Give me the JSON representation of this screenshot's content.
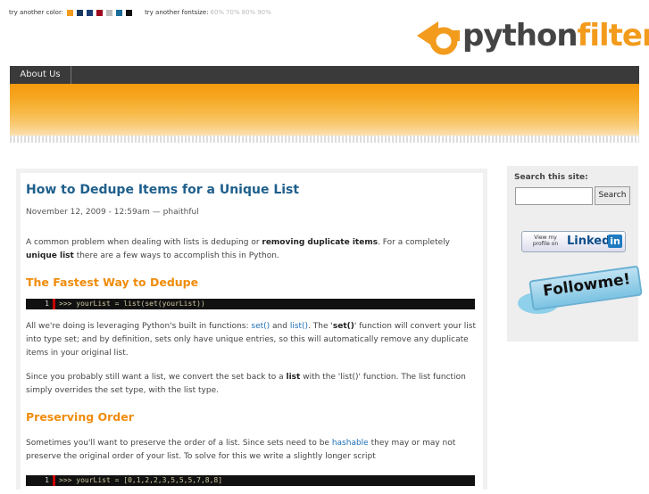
{
  "topbar": {
    "color_label": "try another color:",
    "colors": [
      "#f29b1c",
      "#17375e",
      "#1c3f73",
      "#9e0b1f",
      "#bcbcbc",
      "#1a6c99",
      "#111111"
    ],
    "fontsize_label": "try another fontsize:",
    "fontsizes": [
      "60%",
      "70%",
      "80%",
      "90%"
    ]
  },
  "logo": {
    "part1": "python",
    "part2": "filter"
  },
  "nav": {
    "items": [
      "About Us"
    ]
  },
  "post": {
    "title": "How to Dedupe Items for a Unique List",
    "meta": "November 12, 2009 - 12:59am — phaithful",
    "intro_a": "A common problem when dealing with lists is deduping or ",
    "intro_b": "removing duplicate items",
    "intro_c": ". For a completely ",
    "intro_d": "unique list",
    "intro_e": " there are a few ways to accomplish this in Python.",
    "h2_1": "The Fastest Way to Dedupe",
    "code1_num": "1",
    "code1_text": ">>> yourList = list(set(yourList))",
    "p2_a": "All we're doing is leveraging Python's built in functions: ",
    "p2_link1": "set()",
    "p2_and": " and ",
    "p2_link2": "list()",
    "p2_b": ". The '",
    "p2_bold": "set()",
    "p2_c": "' function will convert your list into type set; and by definition, sets only have unique entries, so this will automatically remove any duplicate items in your original list.",
    "p3_a": "Since you probably still want a list, we convert the set back to a ",
    "p3_bold": "list",
    "p3_b": " with the 'list()' function. The list function simply overrides the set type, with the list type.",
    "h2_2": "Preserving Order",
    "p4_a": "Sometimes you'll want to preserve the order of a list. Since sets need to be ",
    "p4_link": "hashable",
    "p4_b": " they may or may not preserve the original order of your list. To solve for this we write a slightly longer script",
    "code2_num": "1",
    "code2_text": ">>> yourList = [0,1,2,2,3,5,5,5,7,8,8]"
  },
  "sidebar": {
    "search_label": "Search this site:",
    "search_value": "",
    "search_button": "Search",
    "linkedin_view": "View my profile on",
    "linkedin_brand": "Linked",
    "linkedin_in": "in",
    "follow_text": "Followme!"
  }
}
